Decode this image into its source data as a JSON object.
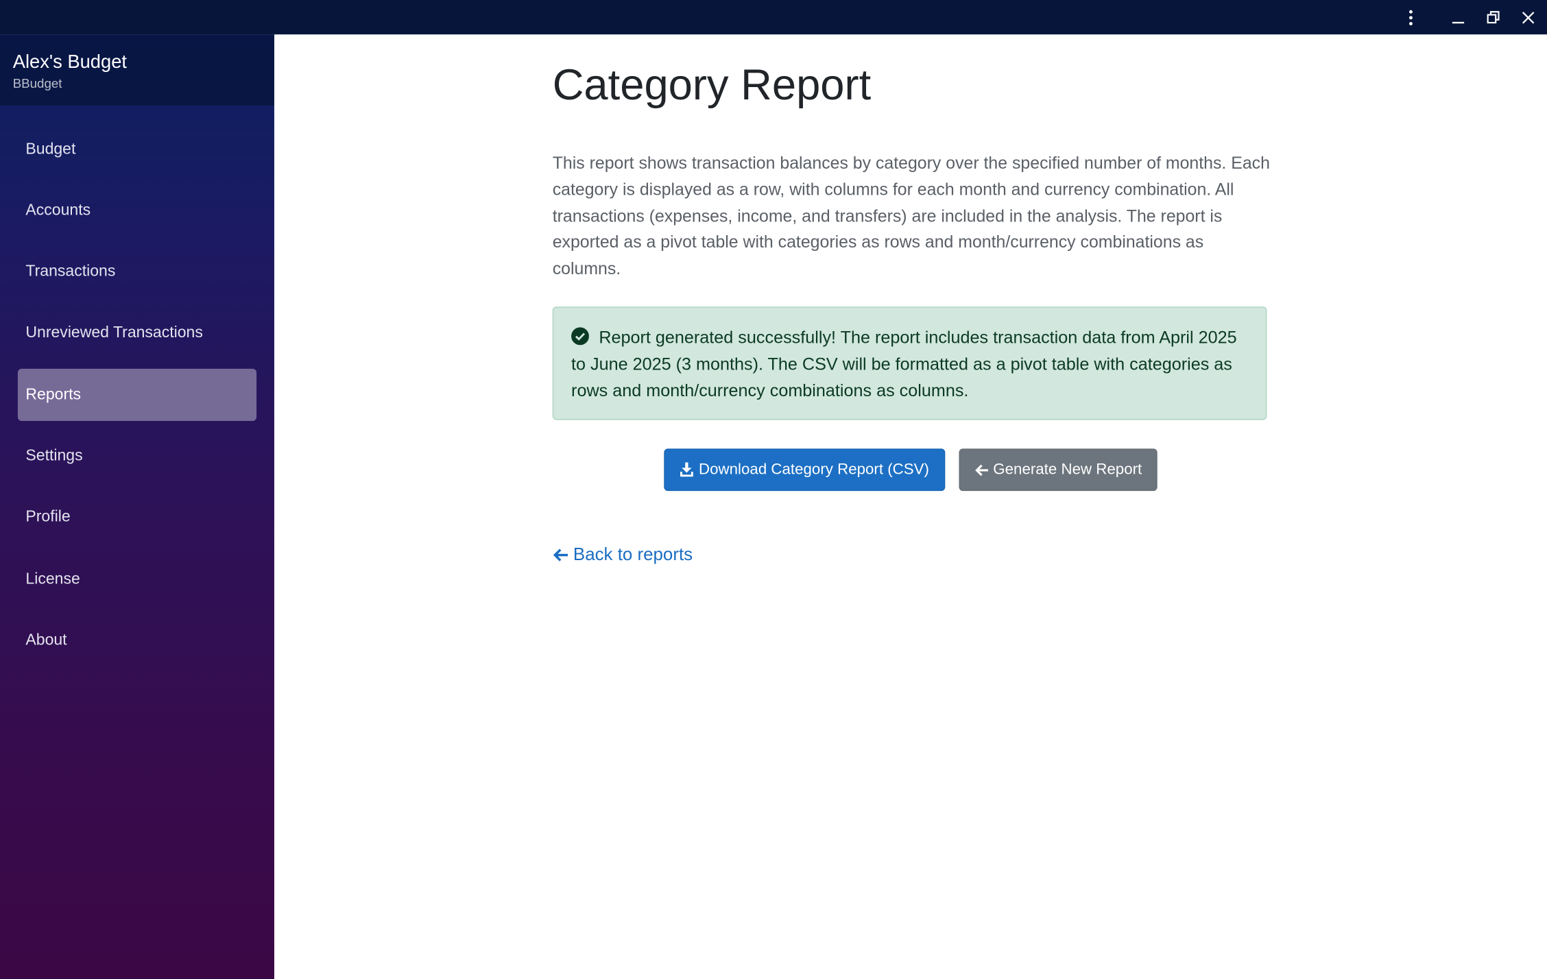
{
  "window": {
    "controls": {
      "menu_icon": "vertical-dots-icon",
      "minimize_icon": "minimize-icon",
      "maximize_icon": "restore-icon",
      "close_icon": "close-icon"
    }
  },
  "sidebar": {
    "app_name": "Alex's Budget",
    "app_subtitle": "BBudget",
    "active_item": "Reports",
    "items": [
      {
        "label": "Budget"
      },
      {
        "label": "Accounts"
      },
      {
        "label": "Transactions"
      },
      {
        "label": "Unreviewed Transactions"
      },
      {
        "label": "Reports"
      },
      {
        "label": "Settings"
      },
      {
        "label": "Profile"
      },
      {
        "label": "License"
      },
      {
        "label": "About"
      }
    ]
  },
  "main": {
    "title": "Category Report",
    "description": "This report shows transaction balances by category over the specified number of months. Each category is displayed as a row, with columns for each month and currency combination. All transactions (expenses, income, and transfers) are included in the analysis. The report is exported as a pivot table with categories as rows and month/currency combinations as columns.",
    "alert": {
      "icon": "check-circle-icon",
      "message": "Report generated successfully! The report includes transaction data from April 2025 to June 2025 (3 months). The CSV will be formatted as a pivot table with categories as rows and month/currency combinations as columns."
    },
    "buttons": {
      "download_label": "Download Category Report (CSV)",
      "download_icon": "download-icon",
      "new_report_label": "Generate New Report",
      "new_report_icon": "arrow-left-icon"
    },
    "back_link": {
      "label": "Back to reports",
      "icon": "arrow-left-icon"
    }
  },
  "colors": {
    "titlebar": "#061539",
    "sidebar_top": "#0c2160",
    "sidebar_bottom": "#3b0744",
    "active_nav": "#766a97",
    "primary_button": "#1c6fc4",
    "secondary_button": "#6c757d",
    "success_alert_bg": "#d2e7de",
    "link": "#1b6dc1"
  }
}
